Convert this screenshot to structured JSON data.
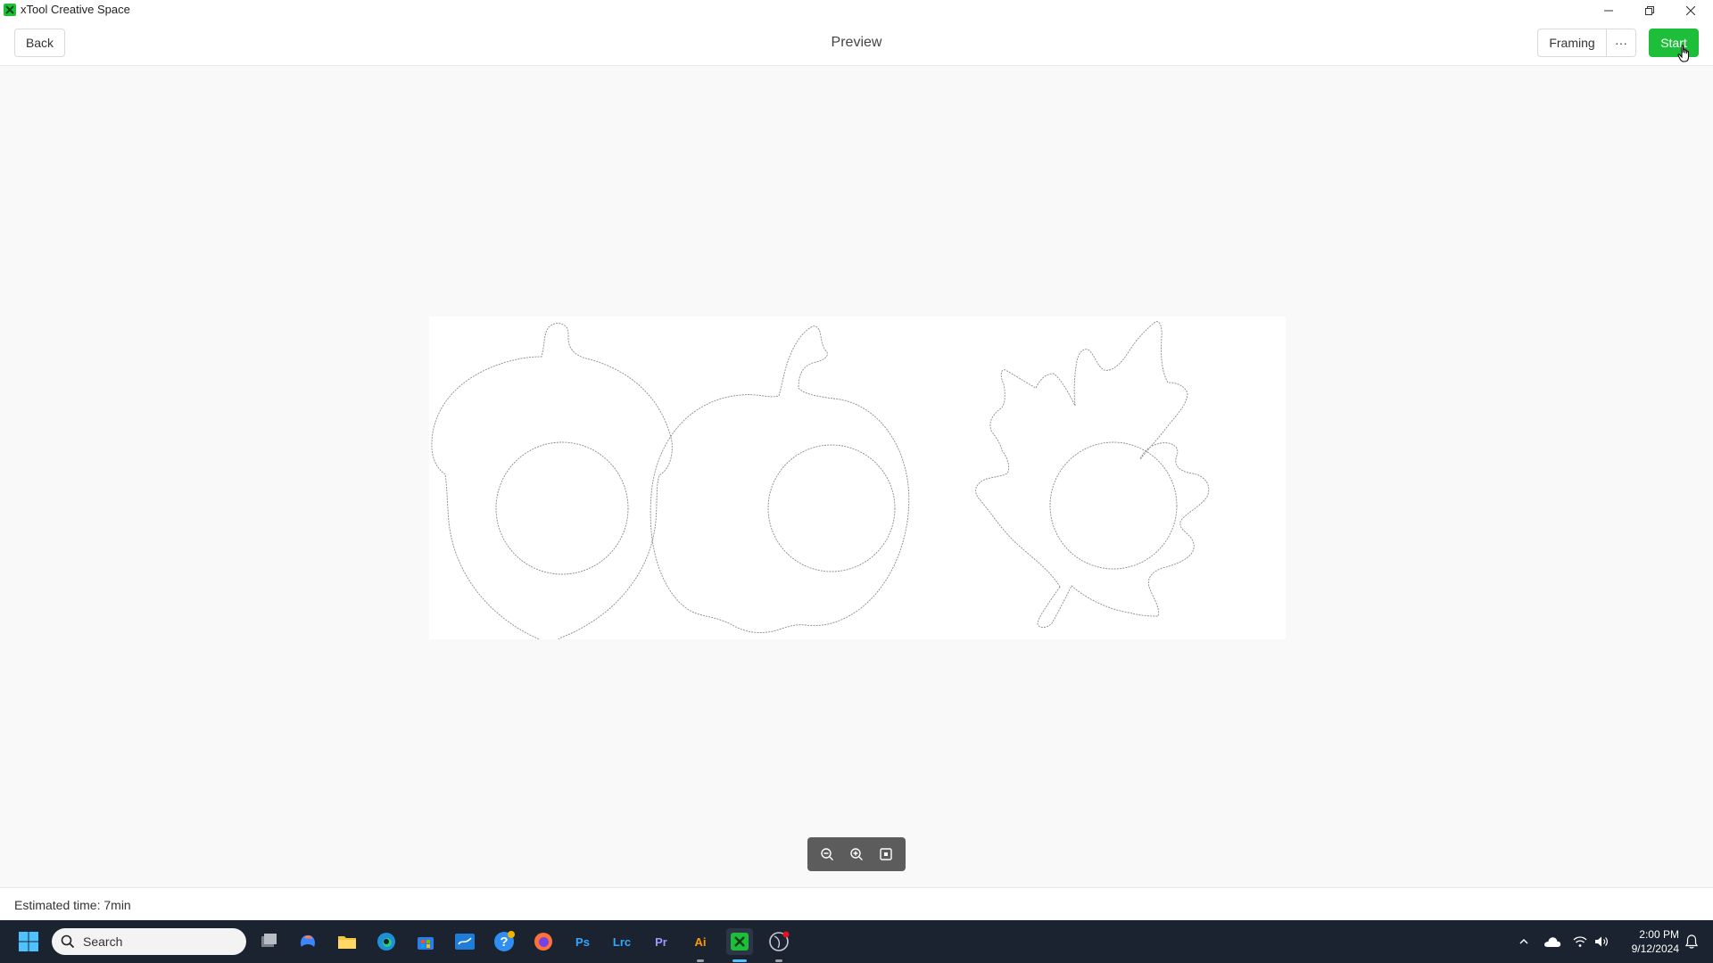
{
  "window": {
    "title": "xTool Creative Space"
  },
  "header": {
    "back_label": "Back",
    "title": "Preview",
    "framing_label": "Framing",
    "more_label": "···",
    "start_label": "Start"
  },
  "canvas": {
    "shapes": [
      "acorn-outline",
      "apple-outline",
      "maple-leaf-outline"
    ]
  },
  "status": {
    "estimated_time": "Estimated time: 7min"
  },
  "taskbar": {
    "search_placeholder": "Search",
    "ps_label": "Ps",
    "lrc_label": "Lrc",
    "pr_label": "Pr",
    "ai_label": "Ai",
    "time": "2:00 PM",
    "date": "9/12/2024"
  },
  "colors": {
    "accent": "#1dbf3a",
    "taskbar": "#1c2330",
    "zoombar": "#5c5c5c"
  }
}
